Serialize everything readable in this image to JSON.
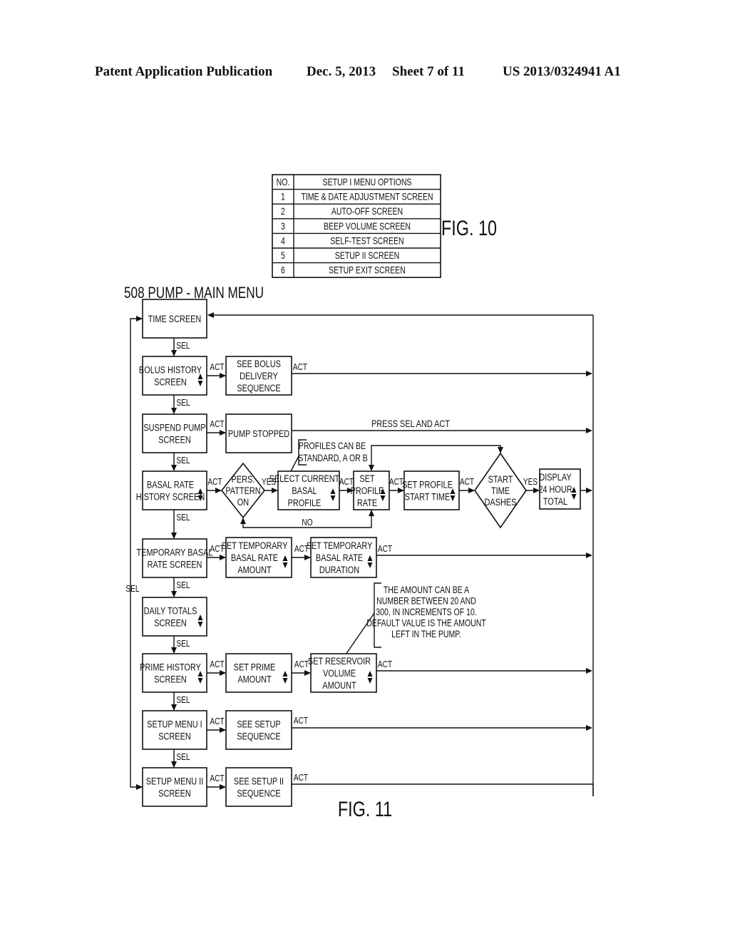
{
  "header": {
    "publication": "Patent Application Publication",
    "date": "Dec. 5, 2013",
    "sheet": "Sheet 7 of 11",
    "number": "US 2013/0324941 A1"
  },
  "fig10": {
    "label": "FIG. 10",
    "col_no": "NO.",
    "col_options": "SETUP I MENU OPTIONS",
    "rows": [
      {
        "no": "1",
        "option": "TIME & DATE ADJUSTMENT SCREEN"
      },
      {
        "no": "2",
        "option": "AUTO-OFF SCREEN"
      },
      {
        "no": "3",
        "option": "BEEP VOLUME SCREEN"
      },
      {
        "no": "4",
        "option": "SELF-TEST SCREEN"
      },
      {
        "no": "5",
        "option": "SETUP II SCREEN"
      },
      {
        "no": "6",
        "option": "SETUP EXIT SCREEN"
      }
    ]
  },
  "fig11": {
    "label": "FIG. 11",
    "title": "508 PUMP - MAIN MENU",
    "sel": "SEL",
    "act": "ACT",
    "yes": "YES",
    "no": "NO",
    "press_sel_act": "PRESS SEL AND ACT",
    "main": [
      {
        "lines": [
          "TIME SCREEN"
        ],
        "updown": false
      },
      {
        "lines": [
          "BOLUS HISTORY",
          "SCREEN"
        ],
        "updown": true
      },
      {
        "lines": [
          "SUSPEND PUMP",
          "SCREEN"
        ],
        "updown": false
      },
      {
        "lines": [
          "BASAL RATE",
          "HISTORY SCREEN"
        ],
        "updown": true
      },
      {
        "lines": [
          "TEMPORARY BASAL",
          "RATE SCREEN"
        ],
        "updown": false
      },
      {
        "lines": [
          "DAILY TOTALS",
          "SCREEN"
        ],
        "updown": true
      },
      {
        "lines": [
          "PRIME HISTORY",
          "SCREEN"
        ],
        "updown": true
      },
      {
        "lines": [
          "SETUP MENU I",
          "SCREEN"
        ],
        "updown": false
      },
      {
        "lines": [
          "SETUP MENU II",
          "SCREEN"
        ],
        "updown": false
      }
    ],
    "sub": {
      "bolus_delivery": {
        "lines": [
          "SEE BOLUS",
          "DELIVERY",
          "SEQUENCE"
        ],
        "updown": false
      },
      "pump_stopped": {
        "lines": [
          "PUMP STOPPED"
        ],
        "updown": false
      },
      "pers_pattern": {
        "lines": [
          "PERS.",
          "PATTERN",
          "ON"
        ]
      },
      "select_profile": {
        "lines": [
          "SELECT CURRENT",
          "BASAL",
          "PROFILE"
        ],
        "updown": true
      },
      "set_profile_rate": {
        "lines": [
          "SET",
          "PROFILE",
          "RATE"
        ],
        "updown": true
      },
      "set_start_time": {
        "lines": [
          "SET PROFILE",
          "START TIME"
        ],
        "updown": true
      },
      "start_time_dashes": {
        "lines": [
          "START",
          "TIME",
          "DASHES"
        ]
      },
      "display_total": {
        "lines": [
          "DISPLAY",
          "24 HOUR",
          "TOTAL"
        ],
        "updown": true
      },
      "temp_amount": {
        "lines": [
          "SET TEMPORARY",
          "BASAL RATE",
          "AMOUNT"
        ],
        "updown": true
      },
      "temp_duration": {
        "lines": [
          "SET TEMPORARY",
          "BASAL RATE",
          "DURATION"
        ],
        "updown": true
      },
      "prime_amount": {
        "lines": [
          "SET PRIME",
          "AMOUNT"
        ],
        "updown": true
      },
      "reservoir": {
        "lines": [
          "SET RESERVOIR",
          "VOLUME",
          "AMOUNT"
        ],
        "updown": true
      },
      "setup_seq": {
        "lines": [
          "SEE SETUP",
          "SEQUENCE"
        ],
        "updown": false
      },
      "setup2_seq": {
        "lines": [
          "SEE SETUP II",
          "SEQUENCE"
        ],
        "updown": false
      }
    },
    "notes": {
      "profiles": [
        "PROFILES CAN BE",
        "STANDARD, A OR B"
      ],
      "amount": [
        "THE AMOUNT CAN BE A",
        "NUMBER BETWEEN 20 AND",
        "300, IN INCREMENTS OF 10.",
        "DEFAULT VALUE IS THE AMOUNT",
        "LEFT IN THE PUMP."
      ]
    }
  }
}
